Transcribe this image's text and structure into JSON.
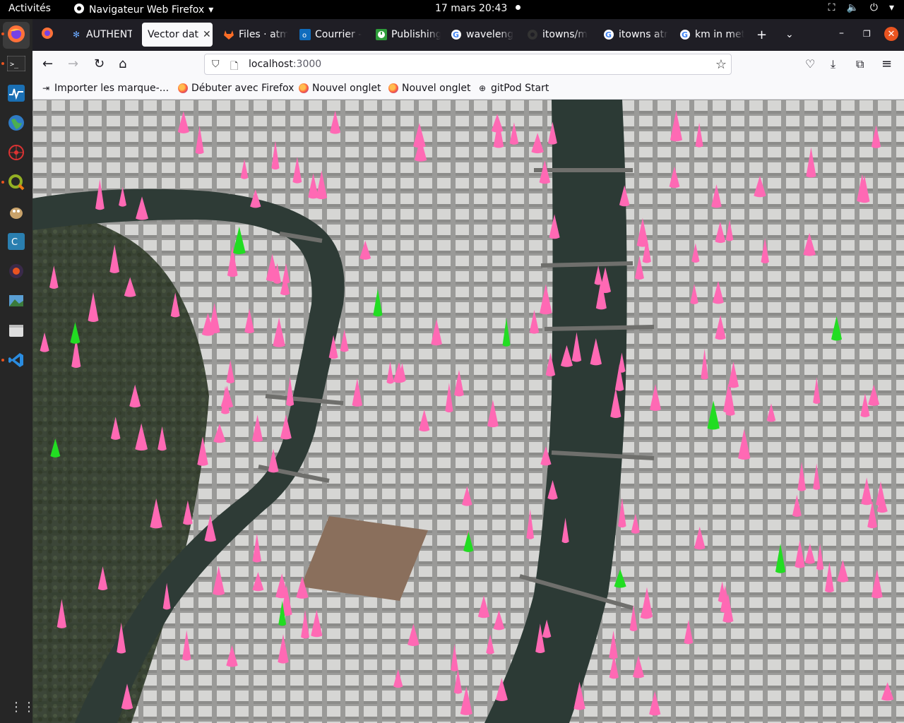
{
  "system_bar": {
    "activities": "Activités",
    "app_name": "Navigateur Web Firefox",
    "clock": "17 mars  20:43"
  },
  "dock": {
    "items": [
      "firefox-icon",
      "terminal-icon",
      "system-monitor-icon",
      "globe-icon",
      "network-icon",
      "qgis-icon",
      "gimp-icon",
      "qtcreator-icon",
      "tool-icon",
      "screenshot-icon",
      "files-icon",
      "vscode-icon"
    ]
  },
  "browser": {
    "tabs": [
      {
        "label": "AUTHENT",
        "icon": "gear-icon"
      },
      {
        "label": "Vector dat",
        "icon": "",
        "selected": true
      },
      {
        "label": "Files · atm",
        "icon": "gitlab-icon"
      },
      {
        "label": "Courrier -",
        "icon": "outlook-icon"
      },
      {
        "label": "Publishing",
        "icon": "clock-icon"
      },
      {
        "label": "waveleng",
        "icon": "google-icon"
      },
      {
        "label": "itowns/m",
        "icon": "github-icon"
      },
      {
        "label": "itowns atr",
        "icon": "google-icon"
      },
      {
        "label": "km in met",
        "icon": "google-icon"
      }
    ],
    "url": {
      "host": "localhost",
      "port": ":3000"
    },
    "bookmarks": [
      {
        "label": "Importer les marque-...",
        "icon": "import-icon"
      },
      {
        "label": "Débuter avec Firefox",
        "icon": "firefox-icon"
      },
      {
        "label": "Nouvel onglet",
        "icon": "firefox-icon"
      },
      {
        "label": "Nouvel onglet",
        "icon": "firefox-icon"
      },
      {
        "label": "gitPod Start",
        "icon": "globe-icon"
      }
    ]
  },
  "map": {
    "marker_colors": {
      "pink": "#ff69b4",
      "green": "#22dd22"
    },
    "pink_marker_count": 170,
    "green_marker_count": 11
  }
}
